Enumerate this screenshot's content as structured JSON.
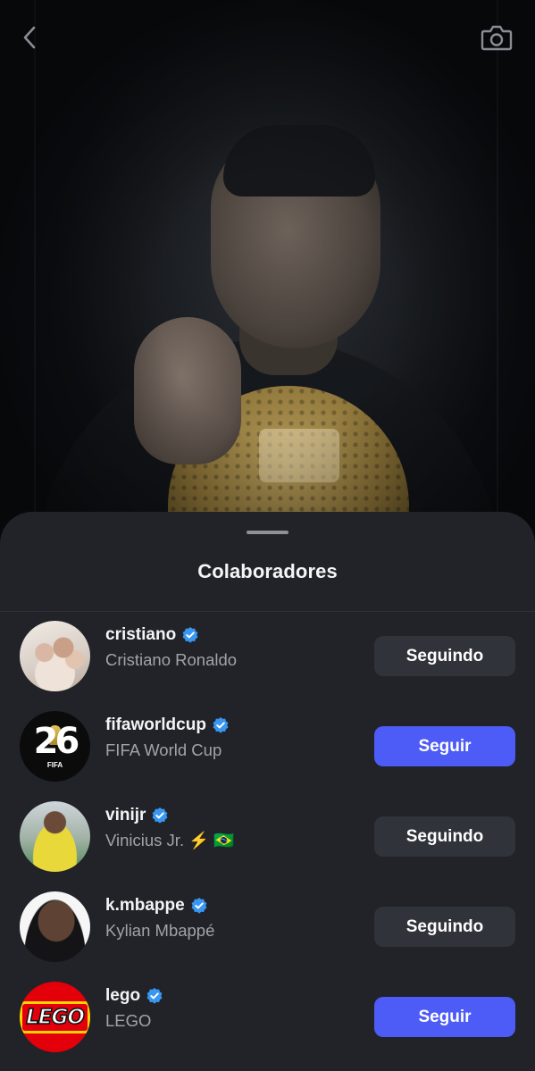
{
  "header": {
    "back_icon": "chevron-left-icon",
    "camera_icon": "camera-icon"
  },
  "sheet": {
    "title": "Colaboradores"
  },
  "collaborators": [
    {
      "handle": "cristiano",
      "name": "Cristiano Ronaldo",
      "verified": true,
      "button": "Seguindo",
      "following": true
    },
    {
      "handle": "fifaworldcup",
      "name": "FIFA World Cup",
      "verified": true,
      "button": "Seguir",
      "following": false
    },
    {
      "handle": "vinijr",
      "name": "Vinicius Jr. ⚡️ 🇧🇷",
      "verified": true,
      "button": "Seguindo",
      "following": true
    },
    {
      "handle": "k.mbappe",
      "name": "Kylian Mbappé",
      "verified": true,
      "button": "Seguindo",
      "following": true
    },
    {
      "handle": "lego",
      "name": "LEGO",
      "verified": true,
      "button": "Seguir",
      "following": false
    }
  ],
  "avatar_text": {
    "fifa_number": "26",
    "fifa_label": "FIFA",
    "lego_logo": "LEGO"
  },
  "colors": {
    "sheet_bg": "#212328",
    "follow_button": "#4d5cf6",
    "following_button": "#30333a",
    "verified_badge": "#3897f0"
  }
}
